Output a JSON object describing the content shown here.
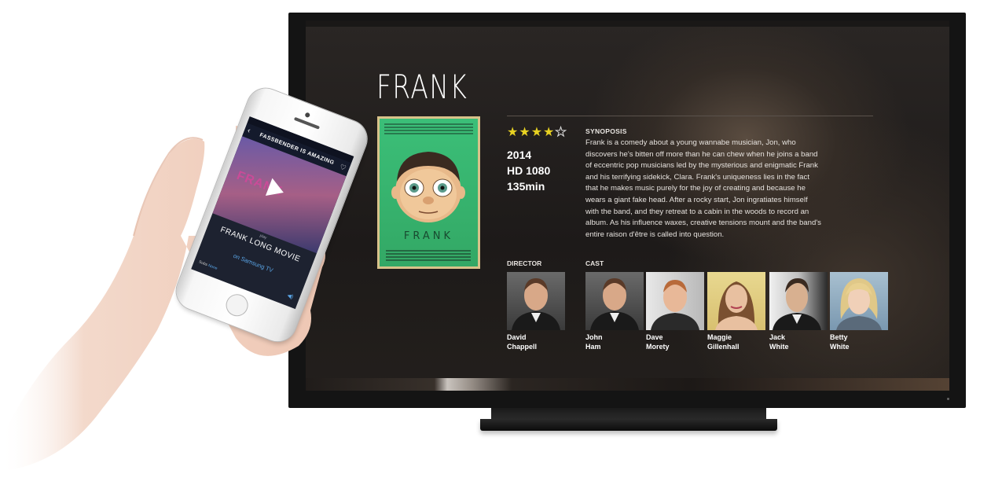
{
  "movie": {
    "title": "FRANK",
    "rating": 4,
    "rating_max": 5,
    "year": "2014",
    "quality": "HD 1080",
    "duration": "135min",
    "synopsis_label": "SYNOPOSIS",
    "synopsis": "Frank is a comedy about a young wannabe musician, Jon, who discovers he's bitten off more than he can chew when he joins a band of eccentric pop musicians led by the mysterious and enigmatic Frank and his terrifying sidekick, Clara. Frank's uniqueness lies in the fact that he makes music purely for the joy of creating and because he wears a giant fake head. After a rocky start, Jon ingratiates himself with the band, and they retreat to a cabin in the woods to record an album. As his influence waxes, creative tensions mount and the band's entire raison d'être is called into question.",
    "poster_title": "FRANK"
  },
  "director": {
    "label": "DIRECTOR",
    "name": "David\nChappell"
  },
  "cast": {
    "label": "CAST",
    "members": [
      {
        "name": "John\nHam"
      },
      {
        "name": "Dave\nMorety"
      },
      {
        "name": "Maggie\nGillenhall"
      },
      {
        "name": "Jack\nWhite"
      },
      {
        "name": "Betty\nWhite"
      }
    ]
  },
  "phone": {
    "header": "FASSBENDER IS AMAZING",
    "hero_text": "FRANK",
    "play_caption": "play",
    "now_title": "FRANK LONG MOVIE",
    "target": "on Samsung TV",
    "subs_label": "Subs",
    "subs_value": "None"
  },
  "colors": {
    "star": "#e8d222",
    "poster_green": "#3bbf78",
    "phone_accent": "#5aa6e8"
  }
}
